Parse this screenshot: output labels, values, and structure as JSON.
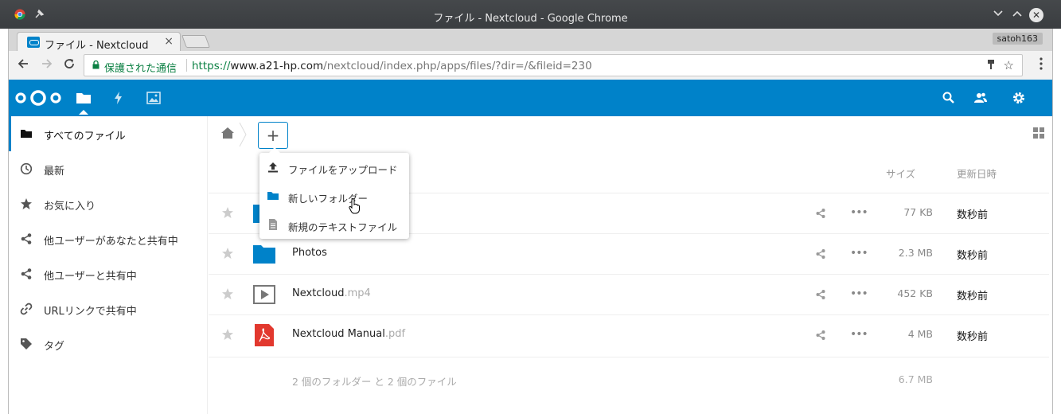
{
  "window": {
    "title": "ファイル - Nextcloud - Google Chrome",
    "buttons": [
      "minimize",
      "maximize",
      "close"
    ]
  },
  "browser": {
    "tab_title": "ファイル - Nextcloud",
    "tab_close": "×",
    "profile_name": "satoh163",
    "secure_label": "保護された通信",
    "url_scheme": "https://",
    "url_host": "www.a21-hp.com",
    "url_path": "/nextcloud/index.php/apps/files/?dir=/&fileid=230"
  },
  "header": {
    "brand_color": "#0082c9",
    "apps": [
      "folder-icon",
      "activity-icon",
      "gallery-icon"
    ],
    "right_icons": [
      "search-icon",
      "contacts-icon",
      "settings-icon"
    ]
  },
  "sidebar": {
    "items": [
      {
        "label": "すべてのファイル",
        "icon": "folder-icon",
        "active": true
      },
      {
        "label": "最新",
        "icon": "clock-icon"
      },
      {
        "label": "お気に入り",
        "icon": "star-icon"
      },
      {
        "label": "他ユーザーがあなたと共有中",
        "icon": "share-icon"
      },
      {
        "label": "他ユーザーと共有中",
        "icon": "share-icon"
      },
      {
        "label": "URLリンクで共有中",
        "icon": "link-icon"
      },
      {
        "label": "タグ",
        "icon": "tag-icon"
      }
    ]
  },
  "toolbar": {
    "add_label": "+"
  },
  "new_menu": {
    "items": [
      {
        "label": "ファイルをアップロード",
        "icon": "upload-icon"
      },
      {
        "label": "新しいフォルダー",
        "icon": "folder-icon"
      },
      {
        "label": "新規のテキストファイル",
        "icon": "text-file-icon"
      }
    ]
  },
  "columns": {
    "size": "サイズ",
    "modified": "更新日時"
  },
  "files": [
    {
      "name": "",
      "ext": "",
      "type": "folder",
      "size": "77 KB",
      "modified": "数秒前"
    },
    {
      "name": "Photos",
      "ext": "",
      "type": "folder",
      "size": "2.3 MB",
      "modified": "数秒前"
    },
    {
      "name": "Nextcloud",
      "ext": ".mp4",
      "type": "video",
      "size": "452 KB",
      "modified": "数秒前"
    },
    {
      "name": "Nextcloud Manual",
      "ext": ".pdf",
      "type": "pdf",
      "size": "4 MB",
      "modified": "数秒前"
    }
  ],
  "summary": {
    "text": "2 個のフォルダー と 2 個のファイル",
    "total": "6.7 MB"
  }
}
